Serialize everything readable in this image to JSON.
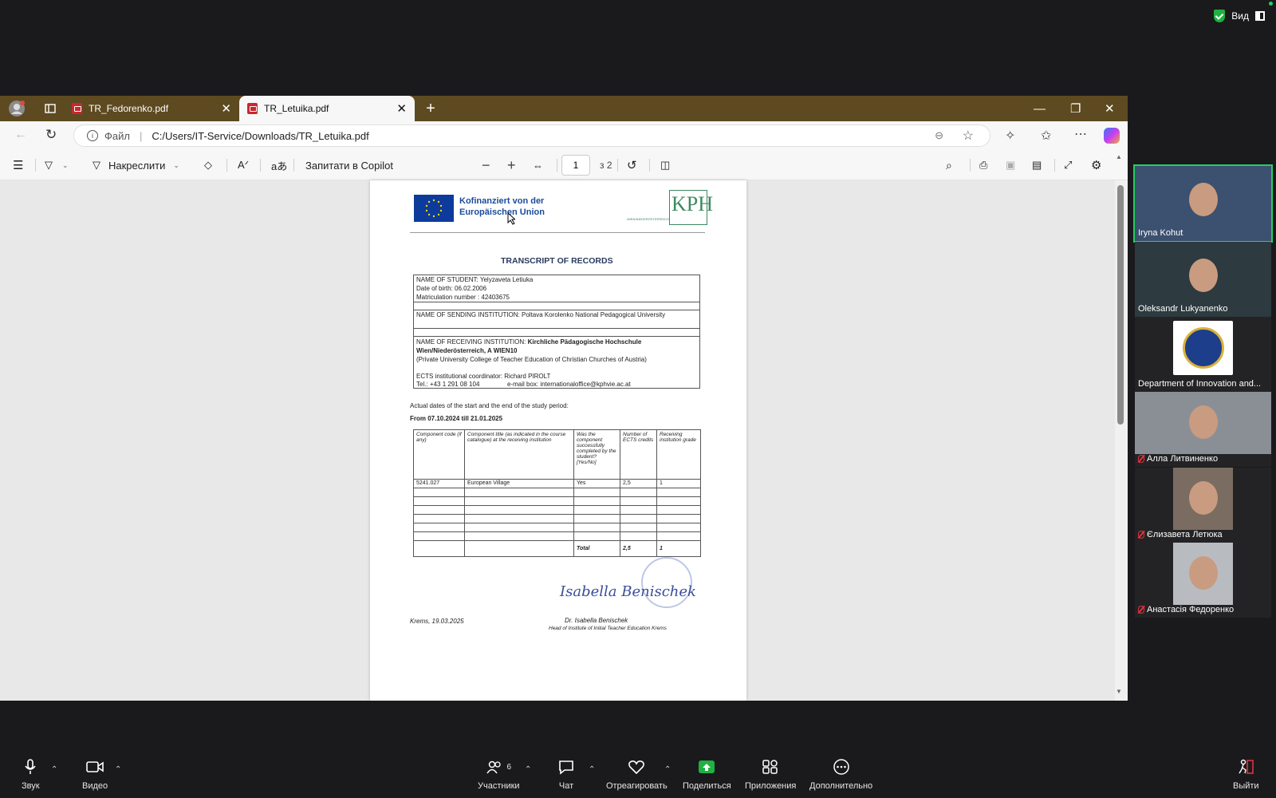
{
  "zoom": {
    "view_label": "Вид",
    "participants": [
      {
        "name": "Iryna Kohut",
        "muted": false,
        "tile_color": "#3c5070"
      },
      {
        "name": "Oleksandr Lukyanenko",
        "muted": false,
        "tile_color": "#2d3a3f"
      },
      {
        "name": "Department of Innovation and...",
        "muted": false,
        "tile_color": "#232325"
      },
      {
        "name": "Алла Литвиненко",
        "muted": true,
        "tile_color": "#8a8f96"
      },
      {
        "name": "Єлизавета Летюка",
        "muted": true,
        "tile_color": "#7a6c60"
      },
      {
        "name": "Анастасія Федоренко",
        "muted": true,
        "tile_color": "#b8bcc0"
      }
    ],
    "bottom": {
      "audio": "Звук",
      "video": "Видео",
      "participants": "Участники",
      "participants_count": "6",
      "chat": "Чат",
      "react": "Отреагировать",
      "share": "Поделиться",
      "apps": "Приложения",
      "more": "Дополнительно",
      "leave": "Выйти"
    }
  },
  "browser": {
    "tabs": [
      {
        "title": "TR_Fedorenko.pdf",
        "active": false
      },
      {
        "title": "TR_Letuika.pdf",
        "active": true
      }
    ],
    "address": {
      "scheme_label": "Файл",
      "url": "C:/Users/IT-Service/Downloads/TR_Letuika.pdf"
    },
    "pdf_toolbar": {
      "draw_label": "Накреслити",
      "copilot_label": "Запитати в Copilot",
      "page_current": "1",
      "page_total": "з 2"
    }
  },
  "document": {
    "eu_line1": "Kofinanziert von der",
    "eu_line2": "Europäischen Union",
    "logo_text": "KPH",
    "logo_sub": "WIEN/NIEDERÖSTERREICH",
    "title": "TRANSCRIPT OF RECORDS",
    "student_name": "NAME OF STUDENT: Yelyzaveta Letiuka",
    "dob": "Date of birth: 06.02.2006",
    "matric": "Matriculation number : 42403675",
    "sending": "NAME OF SENDING INSTITUTION:  Poltava Korolenko National Pedagogical University",
    "receiving_label": "NAME OF RECEIVING INSTITUTION: ",
    "receiving_name": "Kirchliche Pädagogische Hochschule",
    "receiving_city": "Wien/Niederösterreich, A WIEN10",
    "receiving_full": "(Private University College of Teacher Education of Christian Churches of Austria)",
    "coordinator": "ECTS institutional coordinator: Richard PIROLT",
    "tel": "Tel.:   +43 1 291 08 104",
    "email": "e-mail box: internationaloffice@kphvie.ac.at",
    "dates_label": "Actual dates of the start and the end of the study period:",
    "dates": "From 07.10.2024  till 21.01.2025",
    "table": {
      "headers": [
        "Component code (if any)",
        "Component title (as indicated in the course catalogue) at the receiving institution",
        "Was the component successfully completed by the student? [Yes/No]",
        "Number of ECTS credits",
        "Receiving institution grade"
      ],
      "rows": [
        [
          "5241.027",
          "European Village",
          "Yes",
          "2,5",
          "1"
        ],
        [
          "",
          "",
          "",
          "",
          ""
        ],
        [
          "",
          "",
          "",
          "",
          ""
        ],
        [
          "",
          "",
          "",
          "",
          ""
        ],
        [
          "",
          "",
          "",
          "",
          ""
        ],
        [
          "",
          "",
          "",
          "",
          ""
        ],
        [
          "",
          "",
          "",
          "",
          ""
        ]
      ],
      "total_label": "Total",
      "total_credits": "2,5",
      "total_grade": "1"
    },
    "place_date": "Krems, 19.03.2025",
    "signature": "Isabella Benischek",
    "signer": "Dr. Isabella Benischek",
    "signer_title": "Head of Institute of Initial Teacher Education Krems"
  }
}
